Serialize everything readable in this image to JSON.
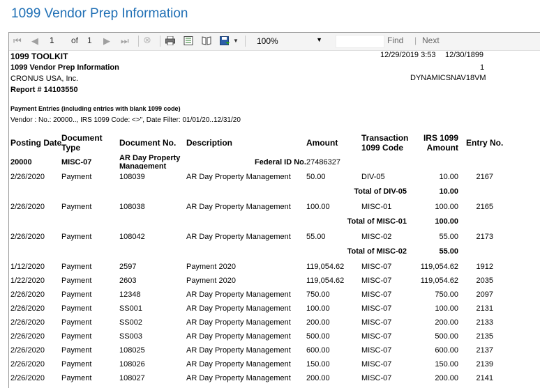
{
  "window": {
    "title": "1099 Vendor Prep Information"
  },
  "toolbar": {
    "current_page": "1",
    "of_label": "of",
    "total_pages": "1",
    "zoom": "100%",
    "find_label": "Find",
    "separator": "|",
    "next_label": "Next",
    "icons": [
      "first-page-icon",
      "previous-page-icon",
      "next-page-icon",
      "last-page-icon",
      "stop-icon",
      "print-icon",
      "print-layout-icon",
      "page-setup-icon",
      "export-icon"
    ]
  },
  "report": {
    "toolkit": "1099 TOOLKIT",
    "name": "1099 Vendor Prep Information",
    "company": "CRONUS USA, Inc.",
    "report_no": "Report # 14103550",
    "date_time": "12/29/2019 3:53",
    "work_date": "12/30/1899",
    "page": "1",
    "server": "DYNAMICSNAV18VM",
    "section_title": "Payment Entries (including entries with blank 1099 code)",
    "filter": "Vendor :  No.: 20000.., IRS 1099 Code: <>\", Date Filter: 01/01/20..12/31/20"
  },
  "columns": {
    "posting_date": "Posting Date",
    "document_type": "Document Type",
    "document_no": "Document No.",
    "description": "Description",
    "amount": "Amount",
    "transaction_code": "Transaction 1099 Code",
    "irs_amount": "IRS 1099 Amount",
    "entry_no": "Entry No."
  },
  "vendor": {
    "no": "20000",
    "code": "MISC-07",
    "name": "AR Day Property Management",
    "federal_label": "Federal ID No.",
    "federal_id": "27486327"
  },
  "groups": [
    {
      "rows": [
        {
          "date": "2/26/2020",
          "type": "Payment",
          "doc": "108039",
          "desc": "AR Day Property Management",
          "amount": "50.00",
          "code": "DIV-05",
          "irs": "10.00",
          "entry": "2167"
        }
      ],
      "total_label": "Total of DIV-05",
      "total": "10.00"
    },
    {
      "rows": [
        {
          "date": "2/26/2020",
          "type": "Payment",
          "doc": "108038",
          "desc": "AR Day Property Management",
          "amount": "100.00",
          "code": "MISC-01",
          "irs": "100.00",
          "entry": "2165"
        }
      ],
      "total_label": "Total of MISC-01",
      "total": "100.00"
    },
    {
      "rows": [
        {
          "date": "2/26/2020",
          "type": "Payment",
          "doc": "108042",
          "desc": "AR Day Property Management",
          "amount": "55.00",
          "code": "MISC-02",
          "irs": "55.00",
          "entry": "2173"
        }
      ],
      "total_label": "Total of MISC-02",
      "total": "55.00"
    },
    {
      "rows": [
        {
          "date": "1/12/2020",
          "type": "Payment",
          "doc": "2597",
          "desc": "Payment 2020",
          "amount": "119,054.62",
          "code": "MISC-07",
          "irs": "119,054.62",
          "entry": "1912"
        },
        {
          "date": "1/22/2020",
          "type": "Payment",
          "doc": "2603",
          "desc": "Payment 2020",
          "amount": "119,054.62",
          "code": "MISC-07",
          "irs": "119,054.62",
          "entry": "2035"
        },
        {
          "date": "2/26/2020",
          "type": "Payment",
          "doc": "12348",
          "desc": "AR Day Property Management",
          "amount": "750.00",
          "code": "MISC-07",
          "irs": "750.00",
          "entry": "2097"
        },
        {
          "date": "2/26/2020",
          "type": "Payment",
          "doc": "SS001",
          "desc": "AR Day Property Management",
          "amount": "100.00",
          "code": "MISC-07",
          "irs": "100.00",
          "entry": "2131"
        },
        {
          "date": "2/26/2020",
          "type": "Payment",
          "doc": "SS002",
          "desc": "AR Day Property Management",
          "amount": "200.00",
          "code": "MISC-07",
          "irs": "200.00",
          "entry": "2133"
        },
        {
          "date": "2/26/2020",
          "type": "Payment",
          "doc": "SS003",
          "desc": "AR Day Property Management",
          "amount": "500.00",
          "code": "MISC-07",
          "irs": "500.00",
          "entry": "2135"
        },
        {
          "date": "2/26/2020",
          "type": "Payment",
          "doc": "108025",
          "desc": "AR Day Property Management",
          "amount": "600.00",
          "code": "MISC-07",
          "irs": "600.00",
          "entry": "2137"
        },
        {
          "date": "2/26/2020",
          "type": "Payment",
          "doc": "108026",
          "desc": "AR Day Property Management",
          "amount": "150.00",
          "code": "MISC-07",
          "irs": "150.00",
          "entry": "2139"
        },
        {
          "date": "2/26/2020",
          "type": "Payment",
          "doc": "108027",
          "desc": "AR Day Property Management",
          "amount": "200.00",
          "code": "MISC-07",
          "irs": "200.00",
          "entry": "2141"
        }
      ]
    }
  ]
}
